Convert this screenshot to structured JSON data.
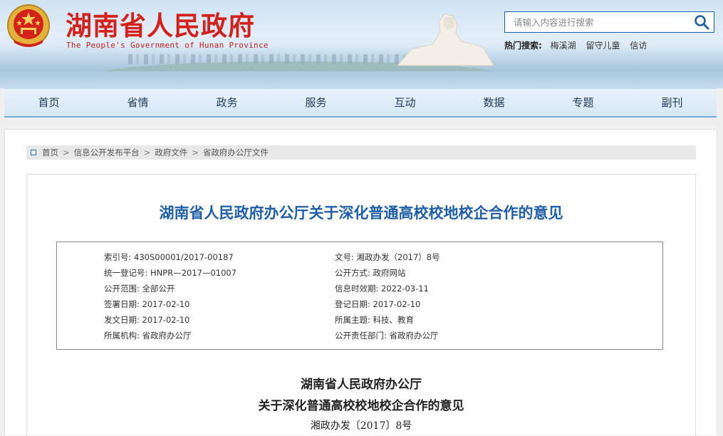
{
  "header": {
    "title": "湖南省人民政府",
    "subtitle": "The People's Government of Hunan Province",
    "search_placeholder": "请输入内容进行搜索",
    "hot_label": "热门搜索:",
    "hot_items": [
      "梅溪湖",
      "留守儿童",
      "信访"
    ]
  },
  "nav": [
    "首页",
    "省情",
    "政务",
    "服务",
    "互动",
    "数据",
    "专题",
    "副刊"
  ],
  "breadcrumb": [
    "首页",
    "信息公开发布平台",
    "政府文件",
    "省政府办公厅文件"
  ],
  "article": {
    "title": "湖南省人民政府办公厅关于深化普通高校校地校企合作的意见",
    "meta": {
      "index_no": "索引号: 430S00001/2017-00187",
      "doc_no": "文号: 湘政办发（2017）8号",
      "register_no": "统一登记号: HNPR—2017—01007",
      "publish_method": "公开方式: 政府网站",
      "scope": "公开范围: 全部公开",
      "valid_until": "信息时效期: 2022-03-11",
      "signed_date": "签署日期: 2017-02-10",
      "register_date": "登记日期: 2017-02-10",
      "issue_date": "发文日期: 2017-02-10",
      "topic": "所属主题: 科技、教育",
      "agency": "所属机构: 省政府办公厅",
      "responsible_dept": "公开责任部门: 省政府办公厅"
    },
    "doc_heading_1": "湖南省人民政府办公厅",
    "doc_heading_2": "关于深化普通高校校地校企合作的意见",
    "doc_number": "湘政办发〔2017〕8号"
  },
  "colors": {
    "brand_red": "#d3211c",
    "brand_blue": "#1f5fa8"
  }
}
